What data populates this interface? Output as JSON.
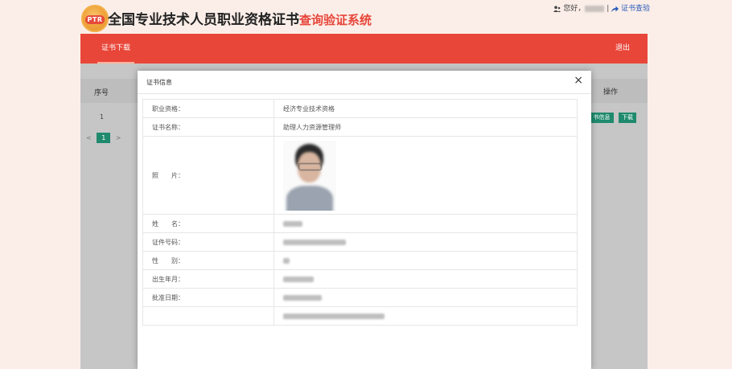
{
  "header": {
    "logo_text": "PTR",
    "title_main": "全国专业技术人员职业资格证书",
    "title_sub": "查询验证系统",
    "user_greeting": "您好，",
    "user_separator": " | ",
    "verify_link": "证书查验"
  },
  "navbar": {
    "tab_label": "证书下载",
    "logout_label": "退出"
  },
  "table": {
    "columns": {
      "seq": "序号",
      "op": "操作"
    },
    "row": {
      "seq": "1",
      "cert_info_btn": "书信息",
      "download_btn": "下载"
    },
    "pager": {
      "prev": "<",
      "current": "1",
      "next": ">"
    }
  },
  "modal": {
    "title": "证书信息",
    "close": "×",
    "rows": {
      "qualification_label": "职业资格：",
      "qualification_value": "经济专业技术资格",
      "cert_name_label": "证书名称：",
      "cert_name_value": "助理人力资源管理师",
      "photo_label": "照　　片：",
      "name_label": "姓　　名：",
      "id_label": "证件号码：",
      "gender_label": "性　　别：",
      "birth_label": "出生年月：",
      "approve_label": "批准日期："
    }
  },
  "colors": {
    "brand_red": "#e9463a",
    "action_green": "#1f8a6d",
    "link_blue": "#2a5bb8"
  },
  "icons": {
    "user": "user-icon",
    "share": "share-arrow-icon",
    "close": "close-icon"
  }
}
